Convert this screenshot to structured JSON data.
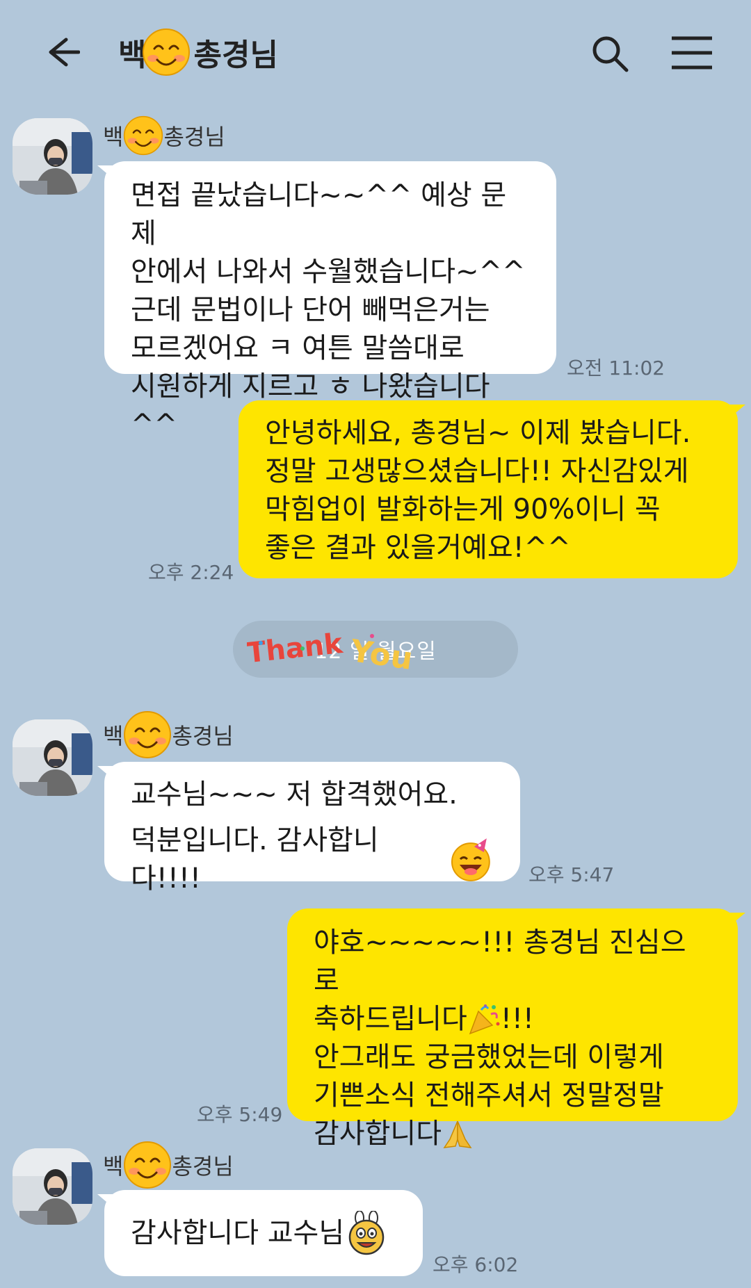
{
  "header": {
    "title_prefix": "백",
    "title_suffix": "총경님",
    "back_icon": "arrow-left-icon",
    "search_icon": "search-icon",
    "menu_icon": "hamburger-menu-icon"
  },
  "messages": [
    {
      "sender_prefix": "백",
      "sender_suffix": "총경님",
      "text": "면접 끝났습니다~~^^ 예상 문제\n안에서 나와서 수월했습니다~^^\n근데 문법이나 단어 빼먹은거는\n모르겠어요 ㅋ 여튼 말씀대로\n시원하게 지르고 ㅎ 나왔습니다^^",
      "time": "오전 11:02"
    },
    {
      "text": "안녕하세요, 총경님~ 이제 봤습니다.\n정말 고생많으셨습니다!! 자신감있게\n막힘업이 발화하는게 90%이니 꼭\n좋은 결과 있을거예요!^^",
      "time": "오후 2:24"
    },
    {
      "date_text": "12 일 월요일",
      "sticker_text": "Thank You"
    },
    {
      "sender_prefix": "백",
      "sender_suffix": "총경님",
      "line1": "교수님~~~ 저 합격했어요.",
      "line2": "덕분입니다. 감사합니다!!!!",
      "time": "오후 5:47"
    },
    {
      "line1": "야호~~~~~!!! 총경님 진심으로",
      "line2": "축하드립니다",
      "line2_end": "!!!",
      "line3": "안그래도 궁금했었는데 이렇게",
      "line4": "기쁜소식 전해주셔서 정말정말",
      "line5": "감사합니다",
      "time": "오후 5:49"
    },
    {
      "sender_prefix": "백",
      "sender_suffix": "총경님",
      "text": "감사합니다 교수님",
      "time": "오후 6:02"
    }
  ],
  "colors": {
    "background": "#b2c7da",
    "outgoing_bubble": "#fee500",
    "incoming_bubble": "#ffffff"
  }
}
